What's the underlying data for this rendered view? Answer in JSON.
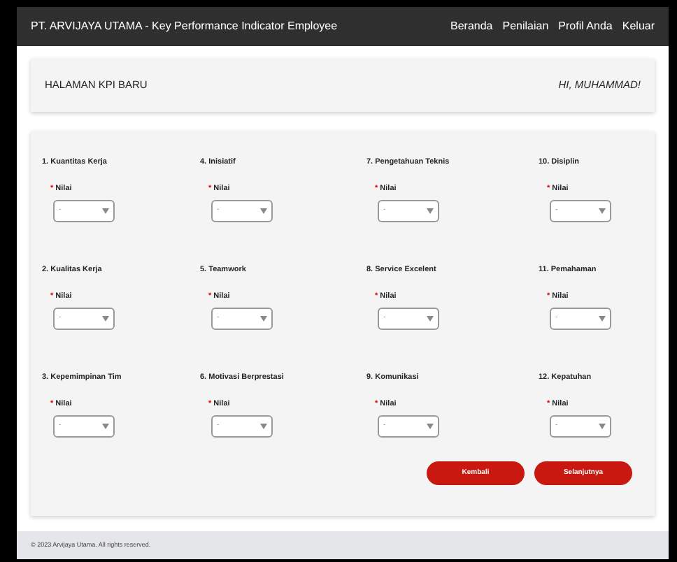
{
  "navbar": {
    "brand": "PT. ARVIJAYA UTAMA - Key Performance Indicator Employee",
    "links": [
      "Beranda",
      "Penilaian",
      "Profil Anda",
      "Keluar"
    ]
  },
  "header": {
    "title": "HALAMAN KPI BARU",
    "greeting": "HI, MUHAMMAD!"
  },
  "criteria": [
    {
      "title": "1. Kuantitas Kerja",
      "required_mark": "*",
      "label": "Nilai",
      "value": "-"
    },
    {
      "title": "2. Kualitas Kerja",
      "required_mark": "*",
      "label": "Nilai",
      "value": "-"
    },
    {
      "title": "3. Kepemimpinan Tim",
      "required_mark": "*",
      "label": "Nilai",
      "value": "-"
    },
    {
      "title": "4. Inisiatif",
      "required_mark": "*",
      "label": "Nilai",
      "value": "-"
    },
    {
      "title": "5. Teamwork",
      "required_mark": "*",
      "label": "Nilai",
      "value": "-"
    },
    {
      "title": "6. Motivasi Berprestasi",
      "required_mark": "*",
      "label": "Nilai",
      "value": "-"
    },
    {
      "title": "7. Pengetahuan Teknis",
      "required_mark": "*",
      "label": "Nilai",
      "value": "-"
    },
    {
      "title": "8. Service Excelent",
      "required_mark": "*",
      "label": "Nilai",
      "value": "-"
    },
    {
      "title": "9. Komunikasi",
      "required_mark": "*",
      "label": "Nilai",
      "value": "-"
    },
    {
      "title": "10. Disiplin",
      "required_mark": "*",
      "label": "Nilai",
      "value": "-"
    },
    {
      "title": "11. Pemahaman",
      "required_mark": "*",
      "label": "Nilai",
      "value": "-"
    },
    {
      "title": "12. Kepatuhan",
      "required_mark": "*",
      "label": "Nilai",
      "value": "-"
    }
  ],
  "buttons": [
    "Kembali",
    "Selanjutnya"
  ],
  "footer": "© 2023 Arvijaya Utama. All rights reserved."
}
